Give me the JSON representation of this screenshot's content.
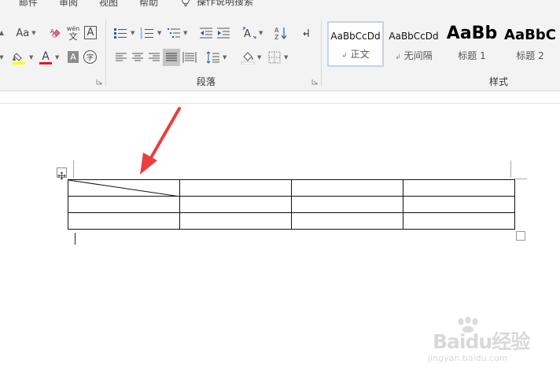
{
  "tabs": {
    "items": [
      {
        "label": "邮件"
      },
      {
        "label": "审阅"
      },
      {
        "label": "视图"
      },
      {
        "label": "帮助"
      }
    ],
    "tell_me": "操作说明搜索"
  },
  "font_group": {
    "change_case": "Aa",
    "phonetic_top": "wén",
    "phonetic_bottom": "文",
    "char_border": "A",
    "font_color": "A",
    "char_shading": "A",
    "enclose": "字",
    "highlight_color": "#ffff00",
    "font_color_value": "#e81123"
  },
  "paragraph_group": {
    "label": "段落",
    "sort": "A↓Z"
  },
  "styles_group": {
    "label": "样式",
    "items": [
      {
        "sample": "AaBbCcDd",
        "name": "正文",
        "mark": "↲",
        "selected": true
      },
      {
        "sample": "AaBbCcDd",
        "name": "无间隔",
        "mark": "↲",
        "selected": false
      },
      {
        "sample": "AaBb",
        "name": "标题 1",
        "mark": "",
        "selected": false
      },
      {
        "sample": "AaBbC",
        "name": "标题 2",
        "mark": "",
        "selected": false
      }
    ]
  },
  "document": {
    "table": {
      "rows": 3,
      "cols": 4,
      "diagonal_header": true,
      "cells": [
        [
          "",
          "",
          "",
          ""
        ],
        [
          "",
          "",
          "",
          ""
        ],
        [
          "",
          "",
          "",
          ""
        ]
      ]
    },
    "arrow_color": "#e8403c"
  },
  "watermark": {
    "text": "Baidu经验",
    "url": "jingyan.baidu.com"
  }
}
